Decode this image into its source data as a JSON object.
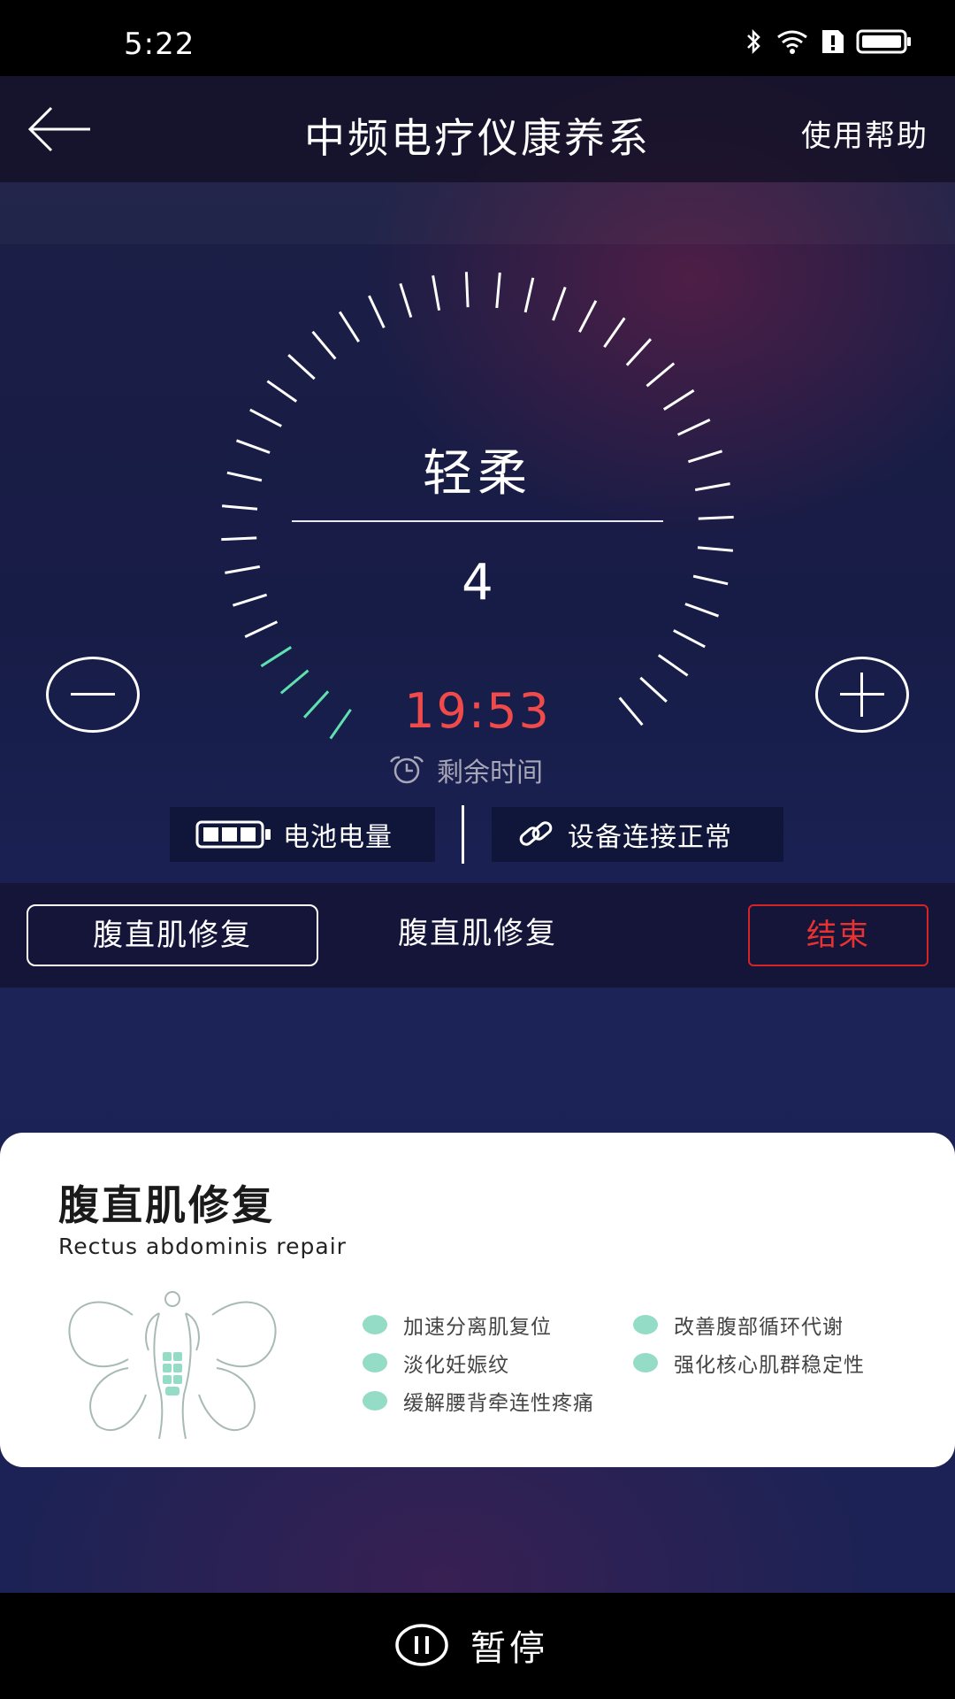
{
  "status_bar": {
    "time": "5:22"
  },
  "header": {
    "title": "中频电疗仪康养系",
    "help": "使用帮助"
  },
  "dial": {
    "mode": "轻柔",
    "intensity": "4",
    "remaining_time": "19:53",
    "remaining_label": "剩余时间",
    "active_tick_color": "#5fe0b0"
  },
  "status_pills": {
    "battery": "电池电量",
    "connection": "设备连接正常"
  },
  "program": {
    "select_label": "腹直肌修复",
    "current": "腹直肌修复",
    "end_label": "结束"
  },
  "card": {
    "title": "腹直肌修复",
    "subtitle": "Rectus abdominis repair",
    "benefits": [
      "加速分离肌复位",
      "改善腹部循环代谢",
      "淡化妊娠纹",
      "强化核心肌群稳定性",
      "缓解腰背牵连性疼痛"
    ]
  },
  "bottom": {
    "pause_label": "暂停"
  },
  "colors": {
    "accent_red": "#e83232",
    "accent_green": "#94dcc6",
    "time_red": "#f04a4a"
  }
}
